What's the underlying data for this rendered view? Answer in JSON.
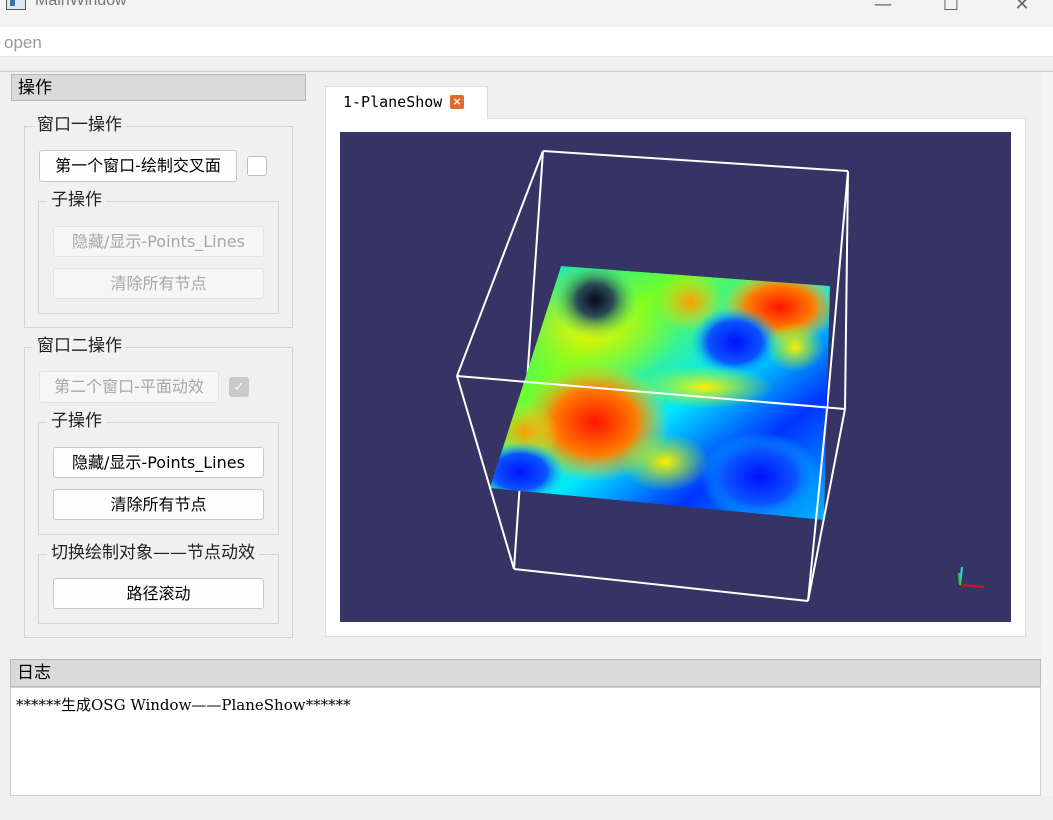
{
  "window": {
    "title": "MainWindow",
    "minimize": "—",
    "maximize": "☐",
    "close": "✕"
  },
  "menu": {
    "open": "open"
  },
  "dock_ops": {
    "title": "操作",
    "window1": {
      "title": "窗口一操作",
      "draw_button": "第一个窗口-绘制交叉面",
      "checked": false,
      "sub": {
        "title": "子操作",
        "toggle_button": "隐藏/显示-Points_Lines",
        "clear_button": "清除所有节点",
        "enabled": false
      }
    },
    "window2": {
      "title": "窗口二操作",
      "anim_button": "第二个窗口-平面动效",
      "checked": true,
      "check_mark": "✓",
      "sub": {
        "title": "子操作",
        "toggle_button": "隐藏/显示-Points_Lines",
        "clear_button": "清除所有节点",
        "enabled": true
      },
      "switch": {
        "title": "切换绘制对象——节点动效",
        "path_button": "路径滚动"
      }
    }
  },
  "tab": {
    "label": "1-PlaneShow",
    "close": "×"
  },
  "viewport": {
    "background": "#353464",
    "box_color": "#ffffff"
  },
  "log": {
    "title": "日志",
    "lines": [
      "******生成OSG Window——PlaneShow******"
    ]
  }
}
